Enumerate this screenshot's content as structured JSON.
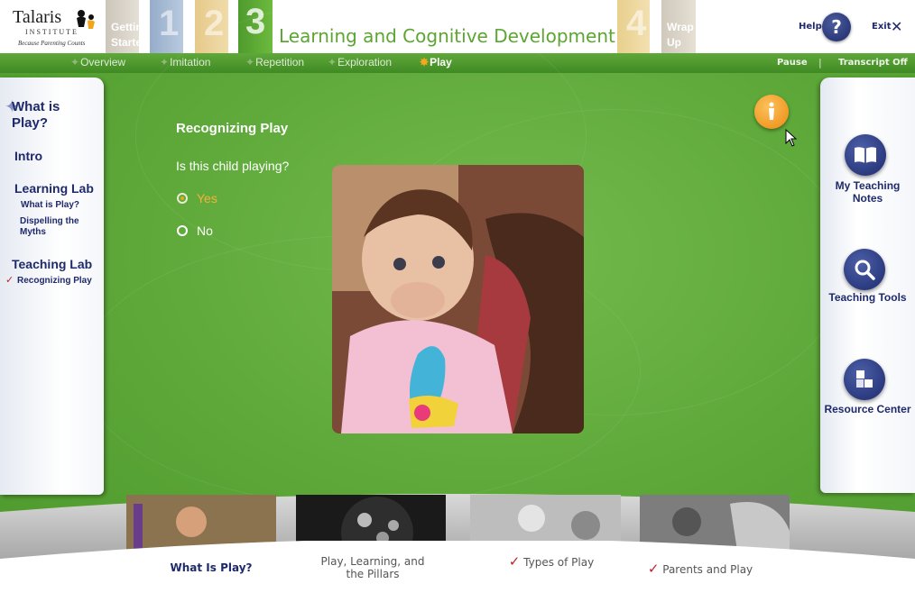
{
  "header": {
    "logo": {
      "brand": "Talaris",
      "institute": "INSTITUTE",
      "tagline": "Because Parenting Counts"
    },
    "tabs": [
      {
        "label": "Getting Started",
        "number": ""
      },
      {
        "label": "",
        "number": "1"
      },
      {
        "label": "",
        "number": "2"
      },
      {
        "label": "",
        "number": "3"
      },
      {
        "label": "",
        "number": "4"
      },
      {
        "label": "Wrap Up",
        "number": ""
      }
    ],
    "module_title": "Learning and Cognitive Development",
    "help_label": "Help",
    "help_icon": "question-mark-icon",
    "exit_label": "Exit",
    "exit_icon": "x-icon"
  },
  "nav": {
    "items": [
      "Overview",
      "Imitation",
      "Repetition",
      "Exploration",
      "Play"
    ],
    "active": "Play",
    "pause_label": "Pause",
    "separator": "|",
    "transcript_label": "Transcript Off"
  },
  "left_panel": {
    "title": "What is Play?",
    "intro": "Intro",
    "learning_lab": "Learning Lab",
    "learning_lab_items": [
      "What is Play?",
      "Dispelling the Myths"
    ],
    "teaching_lab": "Teaching Lab",
    "teaching_lab_items": [
      "Recognizing Play"
    ]
  },
  "content": {
    "title": "Recognizing Play",
    "question": "Is this child playing?",
    "options": [
      {
        "label": "Yes",
        "selected": true
      },
      {
        "label": "No",
        "selected": false
      }
    ]
  },
  "right_panel": {
    "notes_label": "My Teaching Notes",
    "tools_label": "Teaching Tools",
    "resource_label": "Resource Center"
  },
  "bottom": {
    "items": [
      {
        "label": "What Is Play?",
        "checked": false,
        "active": true
      },
      {
        "label": "Play, Learning, and the Pillars",
        "checked": false,
        "active": false
      },
      {
        "label": "Types of Play",
        "checked": true,
        "active": false
      },
      {
        "label": "Parents and Play",
        "checked": true,
        "active": false
      }
    ],
    "check_glyph": "✓"
  },
  "colors": {
    "stage_green": "#5aa536",
    "navy": "#1f2a6b",
    "orange_accent": "#f3b23a",
    "check_red": "#c0202a"
  }
}
